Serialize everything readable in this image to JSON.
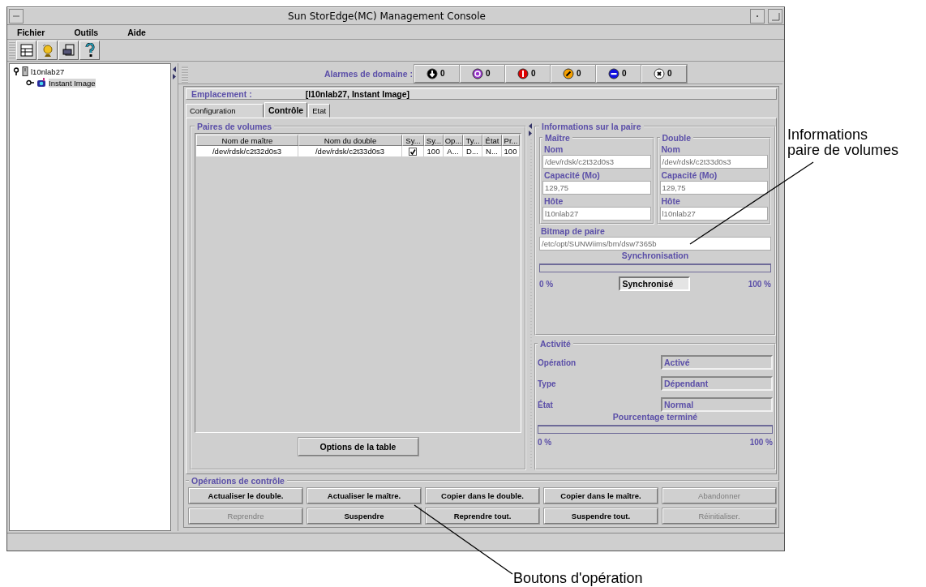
{
  "window": {
    "title": "Sun StorEdge(MC) Management Console"
  },
  "menu": [
    {
      "label": "Fichier"
    },
    {
      "label": "Outils"
    },
    {
      "label": "Aide"
    }
  ],
  "tree": [
    {
      "label": "l10nlab27",
      "expanded": true,
      "selected": false,
      "children": [
        {
          "label": "Instant Image",
          "selected": true
        }
      ]
    }
  ],
  "alarms": {
    "label": "Alarmes de domaine :",
    "items": [
      {
        "kind": "down",
        "count": "0"
      },
      {
        "kind": "unknown",
        "count": "0"
      },
      {
        "kind": "critical",
        "count": "0"
      },
      {
        "kind": "major",
        "count": "0"
      },
      {
        "kind": "minor",
        "count": "0"
      },
      {
        "kind": "info",
        "count": "0"
      }
    ]
  },
  "location": {
    "label": "Emplacement :",
    "value": "[l10nlab27, Instant Image]"
  },
  "tabs": [
    {
      "label": "Configuration",
      "selected": false
    },
    {
      "label": "Contrôle",
      "selected": true
    },
    {
      "label": "Etat",
      "selected": false
    }
  ],
  "pairs": {
    "title": "Paires de volumes",
    "columns": [
      "Nom de maître",
      "Nom du double",
      "Sy...",
      "Sy...",
      "Op...",
      "Ty...",
      "État",
      "Pr..."
    ],
    "rows": [
      {
        "cells": [
          {
            "kind": "text",
            "text": "/dev/rdsk/c2t32d0s3"
          },
          {
            "kind": "text",
            "text": "/dev/rdsk/c2t33d0s3"
          },
          {
            "kind": "check",
            "checked": true
          },
          {
            "kind": "text",
            "text": "100"
          },
          {
            "kind": "text",
            "text": "A..."
          },
          {
            "kind": "text",
            "text": "D..."
          },
          {
            "kind": "text",
            "text": "N..."
          },
          {
            "kind": "text",
            "text": "100"
          }
        ]
      }
    ],
    "button": "Options de la table"
  },
  "info": {
    "title": "Informations sur la paire",
    "sides": [
      {
        "title": "Maître",
        "fields": [
          {
            "label": "Nom",
            "value": "/dev/rdsk/c2t32d0s3"
          },
          {
            "label": "Capacité (Mo)",
            "value": "129,75"
          },
          {
            "label": "Hôte",
            "value": "l10nlab27"
          }
        ]
      },
      {
        "title": "Double",
        "fields": [
          {
            "label": "Nom",
            "value": "/dev/rdsk/c2t33d0s3"
          },
          {
            "label": "Capacité (Mo)",
            "value": "129,75"
          },
          {
            "label": "Hôte",
            "value": "l10nlab27"
          }
        ]
      }
    ],
    "bitmap": {
      "label": "Bitmap de paire",
      "value": "/etc/opt/SUNWiims/bm/dsw7365b"
    },
    "sync": {
      "title": "Synchronisation",
      "level": 0,
      "min": "0 %",
      "max": "100 %",
      "status": "Synchronisé"
    },
    "activity": {
      "title": "Activité",
      "fields": [
        {
          "label": "Opération",
          "value": "Activé"
        },
        {
          "label": "Type",
          "value": "Dépendant"
        },
        {
          "label": "État",
          "value": "Normal"
        }
      ]
    },
    "progress": {
      "title": "Pourcentage terminé",
      "level": 0,
      "min": "0 %",
      "max": "100 %"
    }
  },
  "operations": {
    "title": "Opérations de contrôle",
    "buttons": [
      {
        "label": "Actualiser le double.",
        "disabled": false
      },
      {
        "label": "Actualiser le maître.",
        "disabled": false
      },
      {
        "label": "Copier dans le double.",
        "disabled": false
      },
      {
        "label": "Copier dans le maître.",
        "disabled": false
      },
      {
        "label": "Abandonner",
        "disabled": true
      },
      {
        "label": "Reprendre",
        "disabled": true
      },
      {
        "label": "Suspendre",
        "disabled": false
      },
      {
        "label": "Reprendre tout.",
        "disabled": false
      },
      {
        "label": "Suspendre tout.",
        "disabled": false
      },
      {
        "label": "Réinitialiser.",
        "disabled": true
      }
    ]
  },
  "callouts": [
    {
      "lines": [
        "Informations",
        "paire de volumes"
      ]
    },
    {
      "lines": [
        "Boutons d'opération"
      ]
    }
  ]
}
